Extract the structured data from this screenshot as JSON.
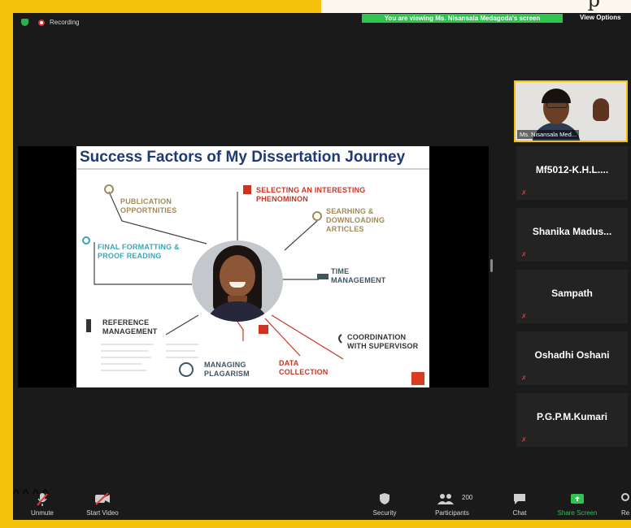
{
  "top_paper_text": "p",
  "status": {
    "recording": "Recording"
  },
  "banner": {
    "viewing": "You are viewing Ms. Nisansala Medagoda's screen",
    "view_options": "View Options"
  },
  "slide": {
    "title": "Success Factors of My Dissertation Journey",
    "labels": {
      "publication": "PUBLICATION\nOPPORTNITIES",
      "selecting": "SELECTING AN INTERESTING\nPHENOMINON",
      "searching": "SEARHING &\nDOWNLOADING\nARTICLES",
      "final": "FINAL FORMATTING &\nPROOF READING",
      "time": "TIME\nMANAGEMENT",
      "reference": "REFERENCE\nMANAGEMENT",
      "coordination": "COORDINATION\nWITH SUPERVISOR",
      "plagarism": "MANAGING\nPLAGARISM",
      "data": "DATA\nCOLLECTION"
    }
  },
  "gallery": {
    "presenter_name": "Ms. Nisansala Med...",
    "participants": [
      "Mf5012-K.H.L....",
      "Shanika  Madus...",
      "Sampath",
      "Oshadhi Oshani",
      "P.G.P.M.Kumari"
    ]
  },
  "toolbar": {
    "unmute": "Unmute",
    "start_video": "Start Video",
    "security": "Security",
    "participants": "Participants",
    "participants_count": "200",
    "chat": "Chat",
    "share_screen": "Share Screen",
    "more": "Re"
  },
  "colors": {
    "frame": "#f4c20d",
    "banner_green": "#2ec44f",
    "slide_title": "#1f3a73",
    "muted_red": "#e23b3b"
  },
  "icons": [
    "shield-icon",
    "record-icon",
    "mic-muted-icon",
    "video-off-icon",
    "security-shield-icon",
    "participants-icon",
    "chat-icon",
    "share-screen-icon"
  ]
}
